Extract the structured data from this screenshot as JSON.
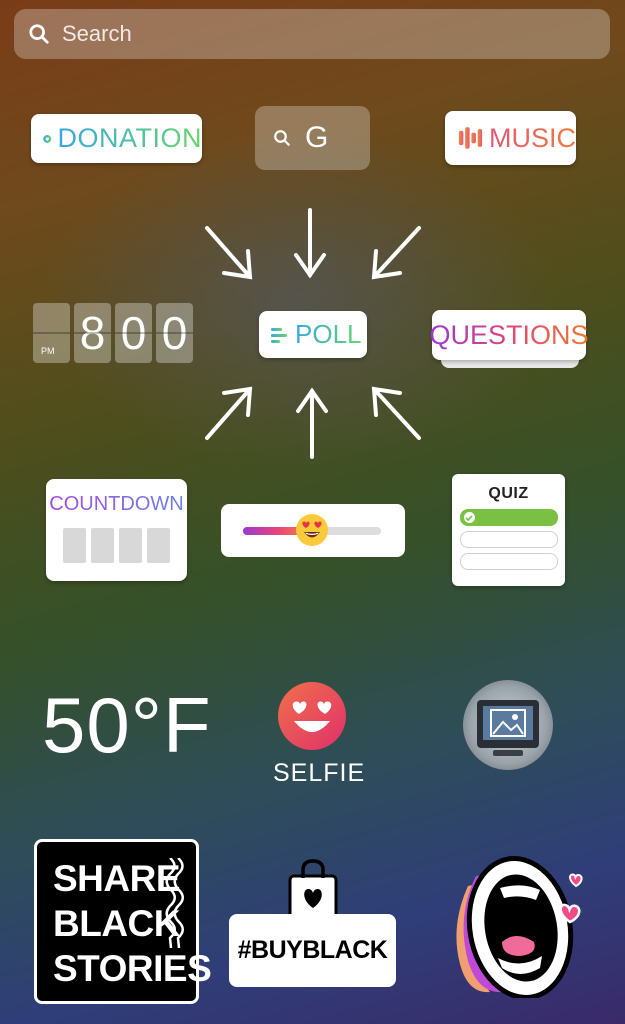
{
  "search": {
    "placeholder": "Search",
    "icon": "search-icon"
  },
  "stickers": {
    "donation": {
      "label": "DONATION",
      "icon": "heart-icon",
      "colors": [
        "#3aa7e0",
        "#66d66a"
      ]
    },
    "gif": {
      "label": "G",
      "icon": "search-icon"
    },
    "music": {
      "label": "MUSIC",
      "icon": "equalizer-icon",
      "colors": [
        "#e05a7a",
        "#f07a3a"
      ]
    },
    "clock": {
      "digits": [
        "",
        "8",
        "0",
        "0"
      ],
      "ampm": "PM"
    },
    "poll": {
      "label": "POLL",
      "icon": "poll-lines-icon"
    },
    "questions": {
      "label": "QUESTIONS"
    },
    "countdown": {
      "label": "COUNTDOWN"
    },
    "slider": {
      "emoji": "heart-eyes-emoji",
      "level": 0.5
    },
    "quiz": {
      "label": "QUIZ"
    },
    "temperature": {
      "value": "50°F"
    },
    "selfie": {
      "label": "SELFIE",
      "icon": "heart-eyes-icon"
    },
    "photo": {
      "icon": "image-icon"
    },
    "share_black_stories": {
      "lines": [
        "SHARE",
        "BLACK",
        "STORIES"
      ]
    },
    "buy_black": {
      "label": "#BUYBLACK",
      "icon": "shopping-bag-heart-icon"
    },
    "mouth": {
      "icon": "shouting-mouth-icon"
    }
  }
}
